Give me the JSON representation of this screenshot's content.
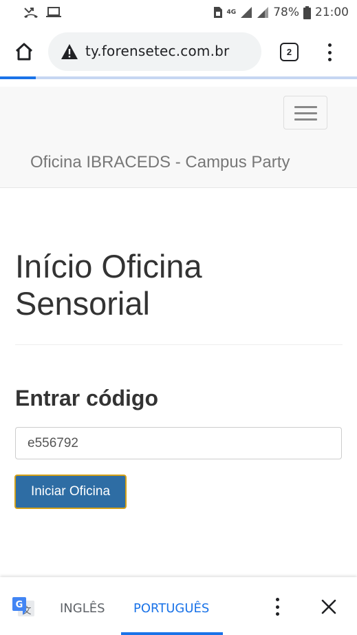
{
  "status_bar": {
    "battery": "78%",
    "time": "21:00",
    "network": "4G"
  },
  "browser": {
    "url": "ty.forensetec.com.br",
    "tab_count": "2",
    "load_progress": 0.1
  },
  "navbar": {
    "brand": "Oficina IBRACEDS - Campus Party"
  },
  "main": {
    "title": "Início Oficina Sensorial",
    "section_title": "Entrar código",
    "code_value": "e556792",
    "start_button": "Iniciar Oficina"
  },
  "translate": {
    "lang_source": "INGLÊS",
    "lang_target": "PORTUGUÊS",
    "selected": "PORTUGUÊS"
  },
  "colors": {
    "accent": "#1a73e8",
    "primary_button": "#2e6da4",
    "focus_ring": "#d4a017"
  }
}
